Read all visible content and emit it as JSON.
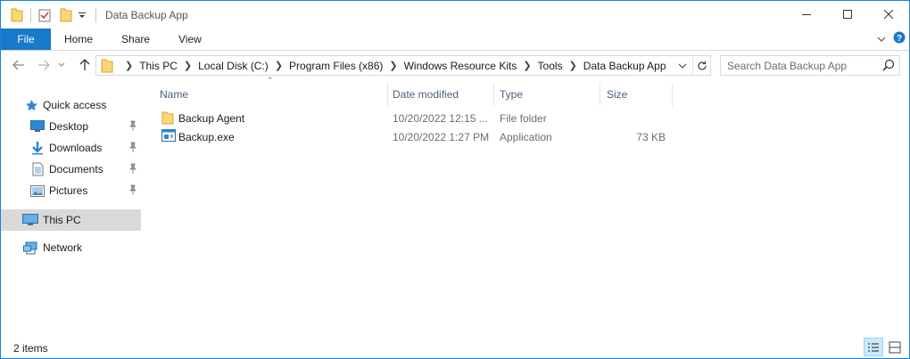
{
  "window": {
    "title": "Data Backup App"
  },
  "ribbon": {
    "tabs": [
      {
        "label": "File"
      },
      {
        "label": "Home"
      },
      {
        "label": "Share"
      },
      {
        "label": "View"
      }
    ]
  },
  "address": {
    "path": [
      "This PC",
      "Local Disk (C:)",
      "Program Files (x86)",
      "Windows Resource Kits",
      "Tools",
      "Data Backup App"
    ]
  },
  "search": {
    "placeholder": "Search Data Backup App"
  },
  "nav": {
    "quick_access": "Quick access",
    "items": [
      {
        "label": "Desktop",
        "icon": "desktop-icon"
      },
      {
        "label": "Downloads",
        "icon": "downloads-icon"
      },
      {
        "label": "Documents",
        "icon": "documents-icon"
      },
      {
        "label": "Pictures",
        "icon": "pictures-icon"
      }
    ],
    "this_pc": "This PC",
    "network": "Network"
  },
  "columns": {
    "name": "Name",
    "date": "Date modified",
    "type": "Type",
    "size": "Size"
  },
  "files": [
    {
      "name": "Backup Agent",
      "date": "10/20/2022 12:15 ...",
      "type": "File folder",
      "size": "",
      "icon": "folder-icon"
    },
    {
      "name": "Backup.exe",
      "date": "10/20/2022 1:27 PM",
      "type": "Application",
      "size": "73 KB",
      "icon": "application-icon"
    }
  ],
  "status": {
    "count": "2 items"
  },
  "colors": {
    "accent": "#1979ca",
    "selected": "#d9d9d9",
    "folder": "#f8d775"
  }
}
